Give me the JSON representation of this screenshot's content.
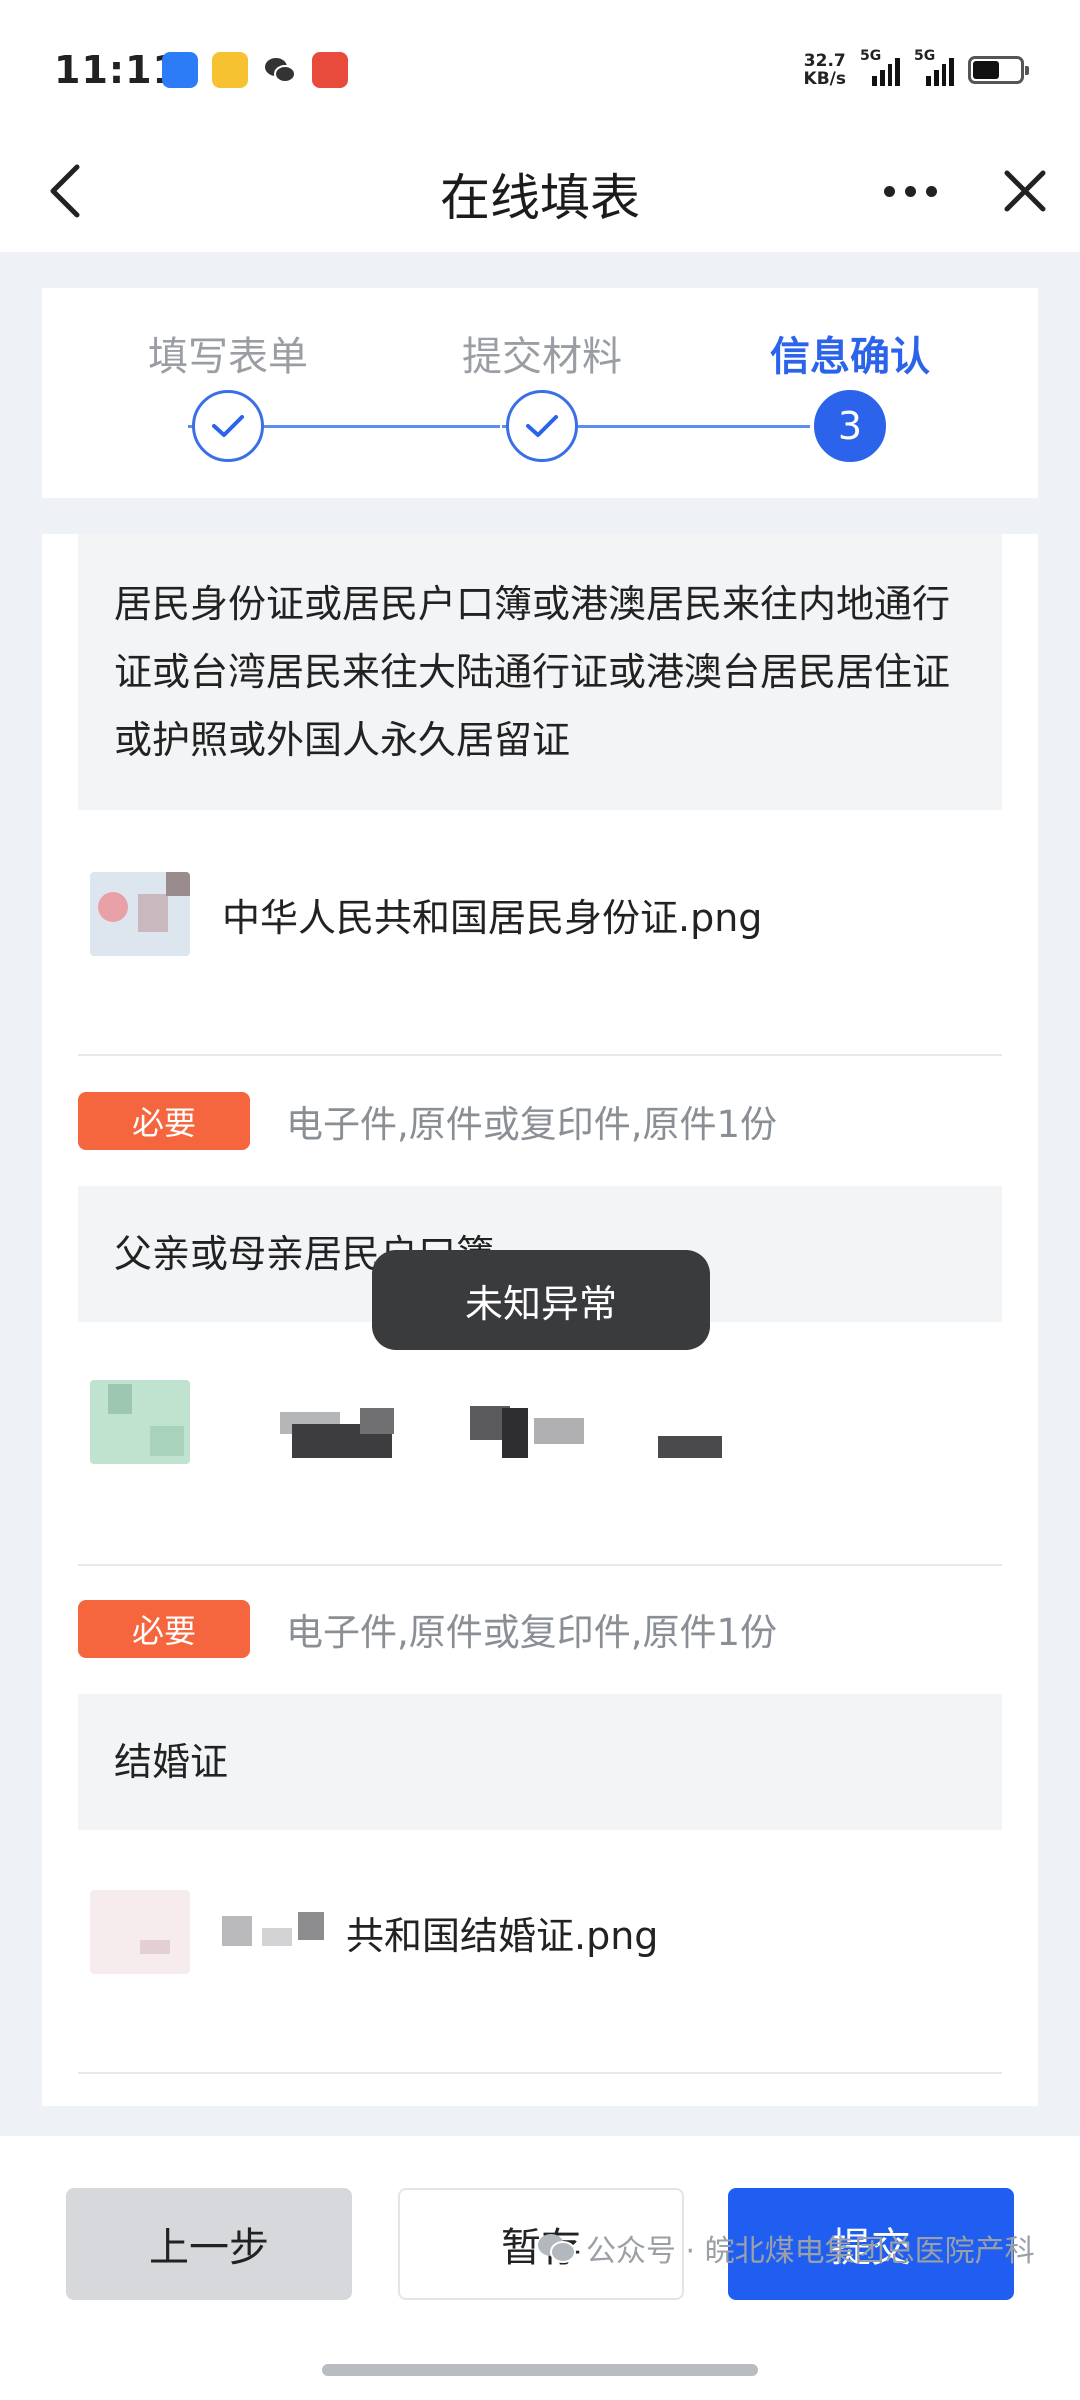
{
  "status_bar": {
    "time": "11:11",
    "net_speed_value": "32.7",
    "net_speed_unit": "KB/s",
    "signal_1_label": "5G",
    "signal_2_label": "5G"
  },
  "nav": {
    "title": "在线填表"
  },
  "stepper": {
    "steps": [
      {
        "label": "填写表单",
        "state": "done"
      },
      {
        "label": "提交材料",
        "state": "done"
      },
      {
        "label": "信息确认",
        "state": "active",
        "number": "3"
      }
    ]
  },
  "materials": [
    {
      "title": "居民身份证或居民户口簿或港澳居民来往内地通行证或台湾居民来往大陆通行证或港澳台居民居住证或护照或外国人永久居留证",
      "file_name": "中华人民共和国居民身份证.png"
    },
    {
      "badge": "必要",
      "requirement": "电子件,原件或复印件,原件1份",
      "title": "父亲或母亲居民户口簿",
      "file_name": ""
    },
    {
      "badge": "必要",
      "requirement": "电子件,原件或复印件,原件1份",
      "title": "结婚证",
      "file_name": "共和国结婚证.png"
    }
  ],
  "toast": "未知异常",
  "buttons": {
    "prev": "上一步",
    "save": "暂存",
    "submit": "提交"
  },
  "watermark": "公众号 · 皖北煤电集团总医院产科",
  "colors": {
    "primary": "#1f5ef0",
    "badge": "#f5663e",
    "step_active_text": "#2b63ea"
  }
}
